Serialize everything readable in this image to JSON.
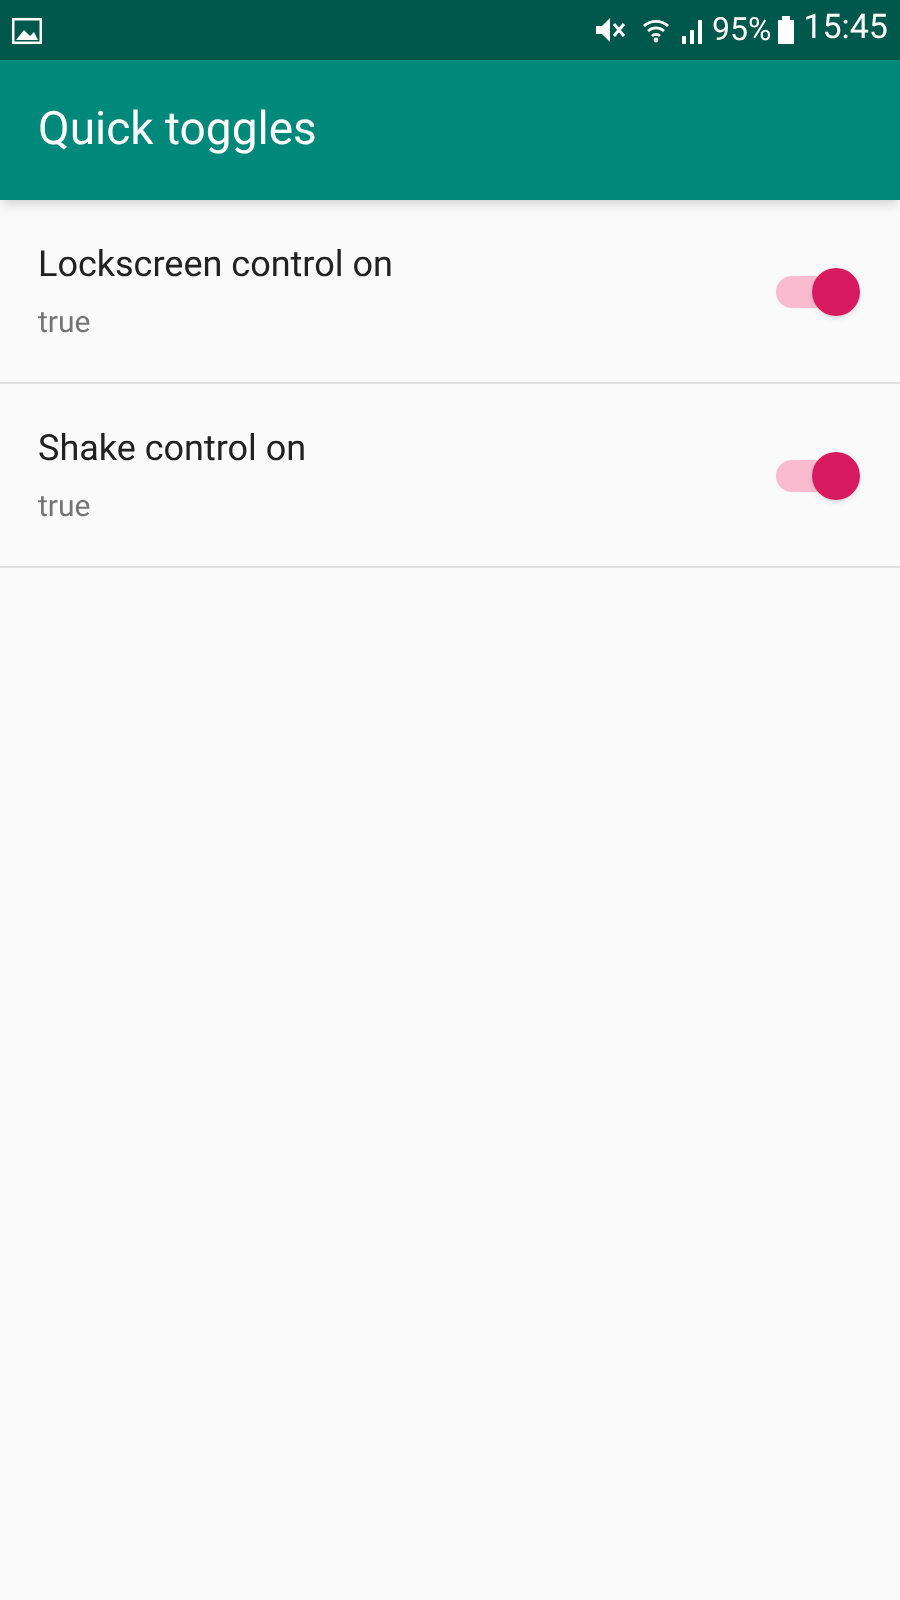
{
  "status_bar": {
    "battery": "95%",
    "time": "15:45"
  },
  "app_bar": {
    "title": "Quick toggles"
  },
  "settings": [
    {
      "title": "Lockscreen control on",
      "summary": "true",
      "on": true
    },
    {
      "title": "Shake control on",
      "summary": "true",
      "on": true
    }
  ]
}
